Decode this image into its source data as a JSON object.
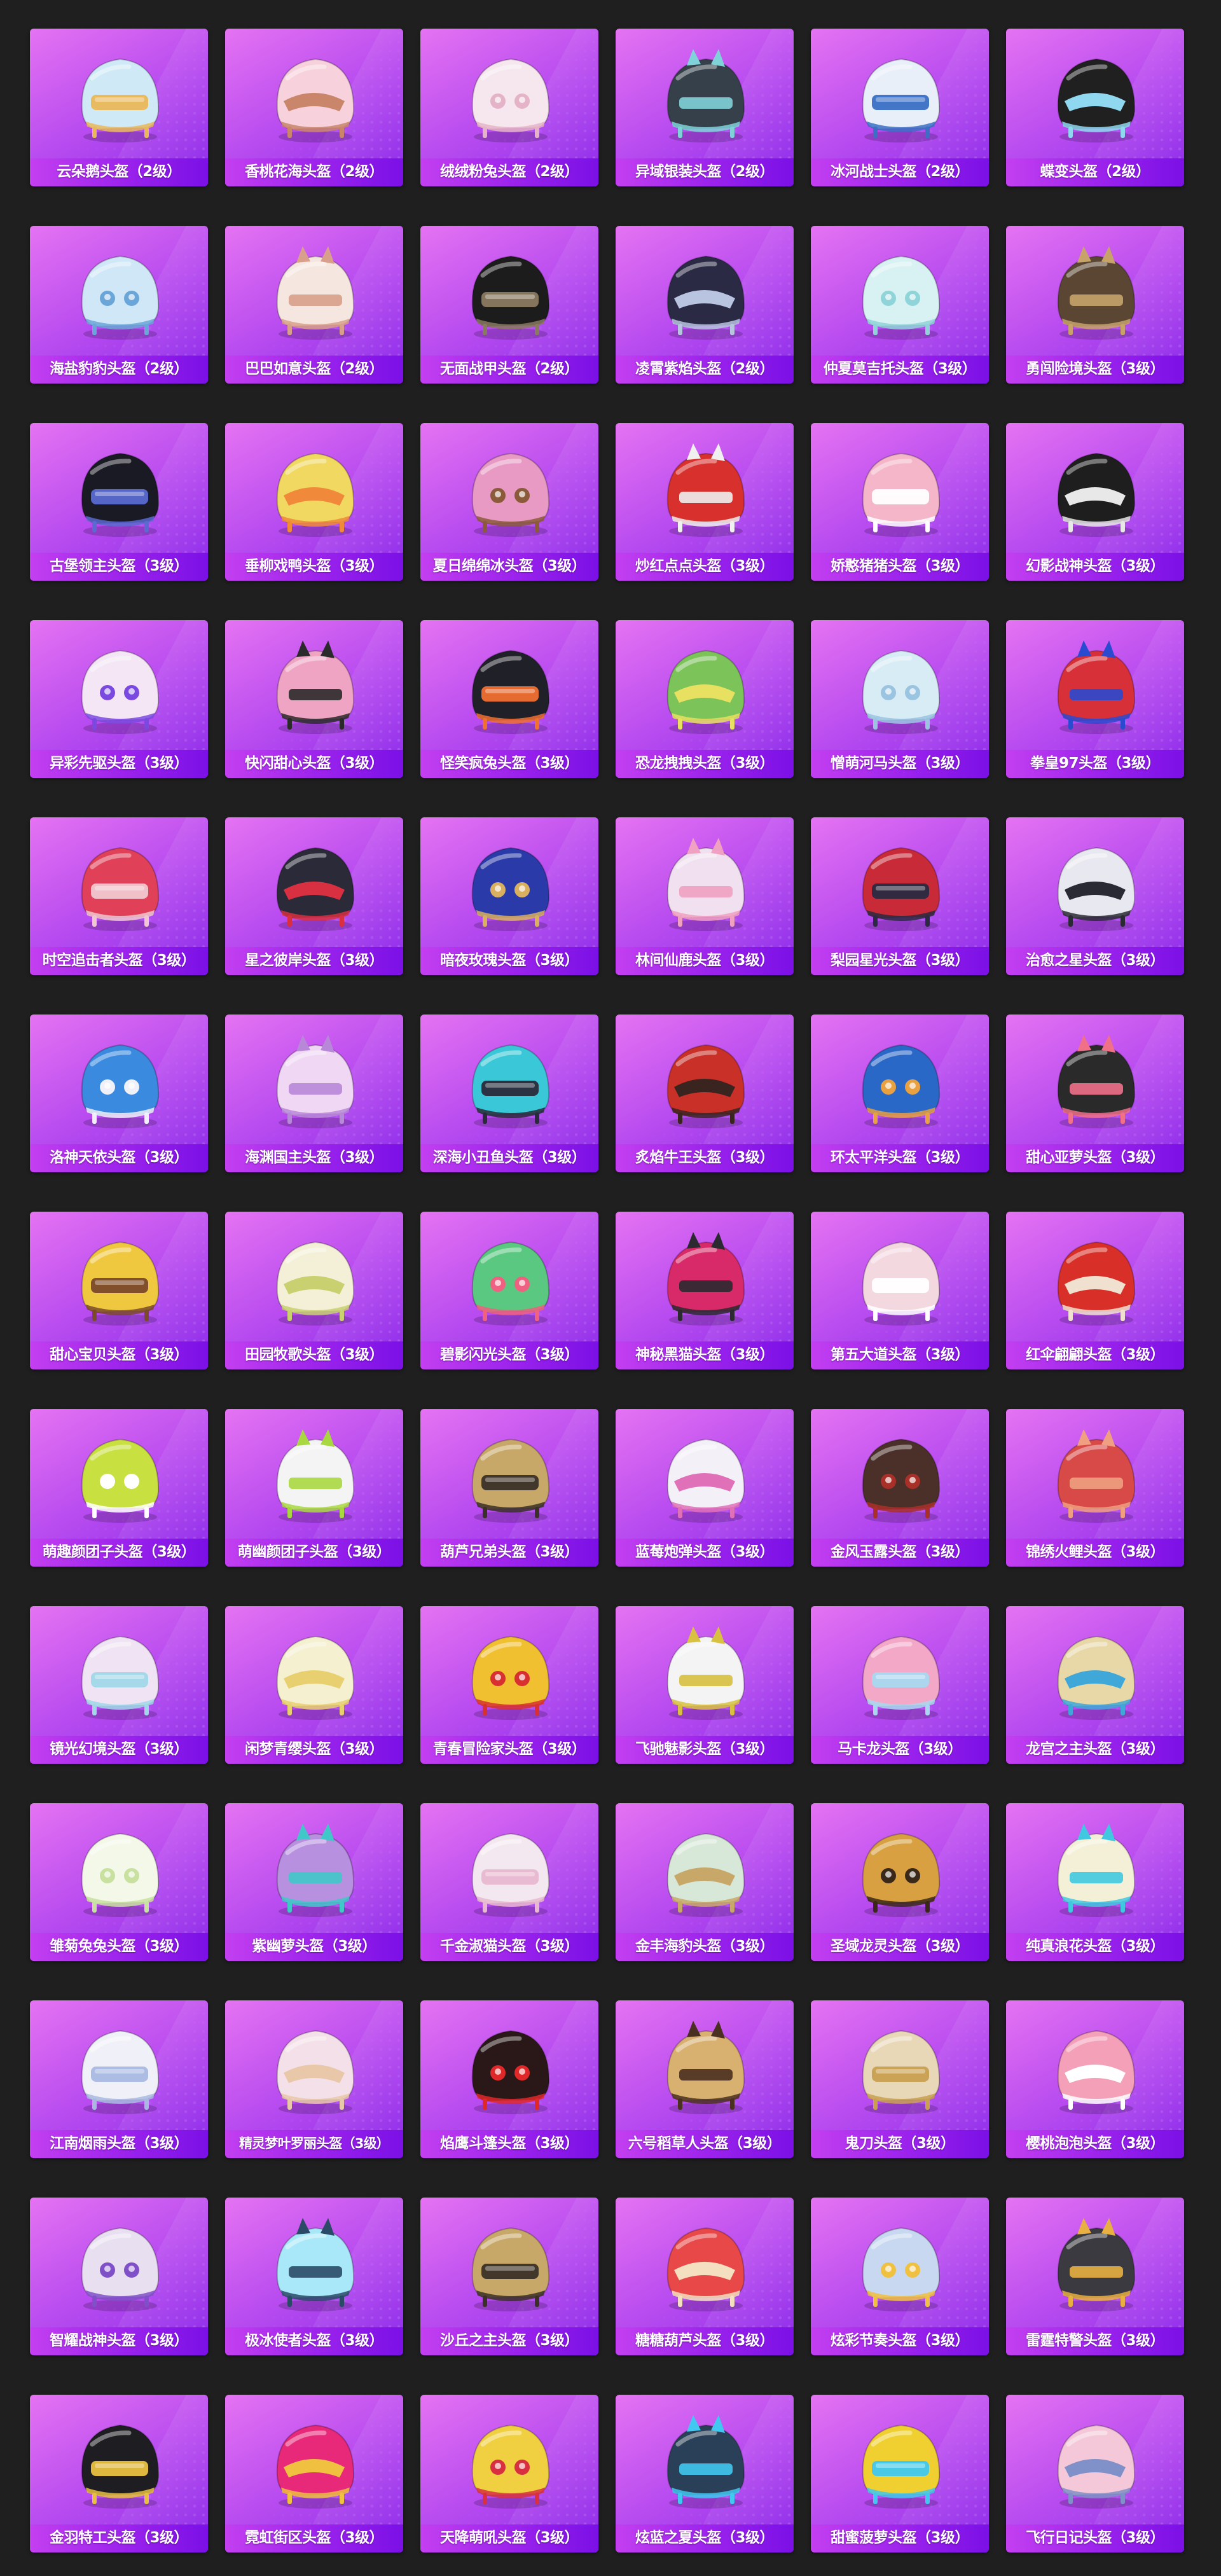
{
  "gallery": {
    "rows": [
      [
        {
          "label": "云朵鹅头盔（2级）",
          "icon": "cloud-goose-helmet-icon",
          "colors": [
            "#cfe9f6",
            "#e9b85a"
          ]
        },
        {
          "label": "香桃花海头盔（2级）",
          "icon": "peach-blossom-helmet-icon",
          "colors": [
            "#f7d2dc",
            "#c9866b"
          ]
        },
        {
          "label": "绒绒粉兔头盔（2级）",
          "icon": "fluffy-pink-bunny-helmet-icon",
          "colors": [
            "#f6e6ee",
            "#e5b3c7"
          ]
        },
        {
          "label": "异域银装头盔（2级）",
          "icon": "exotic-silver-helmet-icon",
          "colors": [
            "#35404a",
            "#7fd3d8"
          ]
        },
        {
          "label": "冰河战士头盔（2级）",
          "icon": "glacier-warrior-helmet-icon",
          "colors": [
            "#e8eff8",
            "#3b6fc4"
          ]
        },
        {
          "label": "蝶变头盔（2级）",
          "icon": "butterfly-helmet-icon",
          "colors": [
            "#202020",
            "#8fd8f0"
          ]
        }
      ],
      [
        {
          "label": "海盐豹豹头盔（2级）",
          "icon": "sea-salt-leopard-helmet-icon",
          "colors": [
            "#cfe7f7",
            "#6aa6d8"
          ]
        },
        {
          "label": "巴巴如意头盔（2级）",
          "icon": "baba-ruyi-helmet-icon",
          "colors": [
            "#f5e6df",
            "#d8a08a"
          ]
        },
        {
          "label": "无面战甲头盔（2级）",
          "icon": "faceless-armor-helmet-icon",
          "colors": [
            "#1c1c1c",
            "#8a7a60"
          ]
        },
        {
          "label": "凌霄紫焰头盔（2级）",
          "icon": "purple-flame-helmet-icon",
          "colors": [
            "#2a2a45",
            "#b8c4e0"
          ]
        },
        {
          "label": "仲夏莫吉托头盔（3级）",
          "icon": "midsummer-mojito-helmet-icon",
          "colors": [
            "#d8f1f2",
            "#8ed4d8"
          ]
        },
        {
          "label": "勇闯险境头盔（3级）",
          "icon": "pirate-ship-helmet-icon",
          "colors": [
            "#5a4632",
            "#c7a36a"
          ]
        }
      ],
      [
        {
          "label": "古堡领主头盔（3级）",
          "icon": "castle-lord-helmet-icon",
          "colors": [
            "#1a1a24",
            "#5a6ad0"
          ]
        },
        {
          "label": "垂柳戏鸭头盔（3级）",
          "icon": "willow-duck-helmet-icon",
          "colors": [
            "#f1d860",
            "#f08a3a"
          ]
        },
        {
          "label": "夏日绵绵冰头盔（3级）",
          "icon": "summer-ice-helmet-icon",
          "colors": [
            "#e89ac4",
            "#8a5a3a"
          ]
        },
        {
          "label": "炒红点点头盔（3级）",
          "icon": "red-dots-helmet-icon",
          "colors": [
            "#d8302c",
            "#f0f0f0"
          ]
        },
        {
          "label": "娇憨猪猪头盔（3级）",
          "icon": "cute-pig-helmet-icon",
          "colors": [
            "#f4b6c8",
            "#ffffff"
          ]
        },
        {
          "label": "幻影战神头盔（3级）",
          "icon": "phantom-war-god-helmet-icon",
          "colors": [
            "#1e1e1e",
            "#e8e8e8"
          ]
        }
      ],
      [
        {
          "label": "异彩先驱头盔（3级）",
          "icon": "colorful-pioneer-helmet-icon",
          "colors": [
            "#f4e6f4",
            "#7a4ae0"
          ]
        },
        {
          "label": "快闪甜心头盔（3级）",
          "icon": "flash-sweetheart-helmet-icon",
          "colors": [
            "#f0a4c4",
            "#2a2a2a"
          ]
        },
        {
          "label": "怪笑疯兔头盔（3级）",
          "icon": "crazy-rabbit-helmet-icon",
          "colors": [
            "#202028",
            "#f07030"
          ]
        },
        {
          "label": "恐龙拽拽头盔（3级）",
          "icon": "dinosaur-helmet-icon",
          "colors": [
            "#7cc45a",
            "#e8e060"
          ]
        },
        {
          "label": "憎萌河马头盔（3级）",
          "icon": "hippo-helmet-icon",
          "colors": [
            "#d8ecf6",
            "#9ac4e0"
          ]
        },
        {
          "label": "拳皇97头盔（3级）",
          "icon": "kof97-helmet-icon",
          "colors": [
            "#d83038",
            "#2a4ad0"
          ]
        }
      ],
      [
        {
          "label": "时空追击者头盔（3级）",
          "icon": "time-chaser-helmet-icon",
          "colors": [
            "#e04058",
            "#f0c8d0"
          ]
        },
        {
          "label": "星之彼岸头盔（3级）",
          "icon": "star-shore-helmet-icon",
          "colors": [
            "#2a2a38",
            "#d83040"
          ]
        },
        {
          "label": "暗夜玫瑰头盔（3级）",
          "icon": "night-rose-helmet-icon",
          "colors": [
            "#2a3aa8",
            "#d8b060"
          ]
        },
        {
          "label": "林间仙鹿头盔（3级）",
          "icon": "forest-deer-helmet-icon",
          "colors": [
            "#f0e0f0",
            "#f0a0c0"
          ]
        },
        {
          "label": "梨园星光头盔（3级）",
          "icon": "opera-star-helmet-icon",
          "colors": [
            "#c82a38",
            "#2a2a40"
          ]
        },
        {
          "label": "治愈之星头盔（3级）",
          "icon": "healing-star-helmet-icon",
          "colors": [
            "#e8e8f0",
            "#2a2a34"
          ]
        }
      ],
      [
        {
          "label": "洛神天依头盔（3级）",
          "icon": "luo-tianyi-helmet-icon",
          "colors": [
            "#3a8ae0",
            "#f0f0f8"
          ]
        },
        {
          "label": "海渊国主头盔（3级）",
          "icon": "sea-abyss-lord-helmet-icon",
          "colors": [
            "#f0d8f4",
            "#b888d8"
          ]
        },
        {
          "label": "深海小丑鱼头盔（3级）",
          "icon": "clownfish-helmet-icon",
          "colors": [
            "#3ac8d8",
            "#2a2a3a"
          ]
        },
        {
          "label": "炙焰牛王头盔（3级）",
          "icon": "flame-bull-king-helmet-icon",
          "colors": [
            "#c83028",
            "#3a2420"
          ]
        },
        {
          "label": "环太平洋头盔（3级）",
          "icon": "pacific-rim-helmet-icon",
          "colors": [
            "#2a68c8",
            "#e8a040"
          ]
        },
        {
          "label": "甜心亚萝头盔（3级）",
          "icon": "sweet-yaluo-helmet-icon",
          "colors": [
            "#2a2a2a",
            "#f07088"
          ]
        }
      ],
      [
        {
          "label": "甜心宝贝头盔（3级）",
          "icon": "sweet-baby-helmet-icon",
          "colors": [
            "#f0c840",
            "#7a4a2a"
          ]
        },
        {
          "label": "田园牧歌头盔（3级）",
          "icon": "pastoral-helmet-icon",
          "colors": [
            "#f4f0d8",
            "#c8d070"
          ]
        },
        {
          "label": "碧影闪光头盔（3级）",
          "icon": "jade-flash-helmet-icon",
          "colors": [
            "#5ac880",
            "#f06080"
          ]
        },
        {
          "label": "神秘黑猫头盔（3级）",
          "icon": "mystic-black-cat-helmet-icon",
          "colors": [
            "#d82a68",
            "#2a2a30"
          ]
        },
        {
          "label": "第五大道头盔（3级）",
          "icon": "fifth-avenue-helmet-icon",
          "colors": [
            "#f4d8e0",
            "#ffffff"
          ]
        },
        {
          "label": "红伞翩翩头盔（3级）",
          "icon": "red-umbrella-helmet-icon",
          "colors": [
            "#d83028",
            "#f0e0d0"
          ]
        }
      ],
      [
        {
          "label": "萌趣颜团子头盔（3级）",
          "icon": "cute-dumpling-helmet-icon",
          "colors": [
            "#c8e040",
            "#ffffff"
          ]
        },
        {
          "label": "萌幽颜团子头盔（3级）",
          "icon": "ghost-dumpling-helmet-icon",
          "colors": [
            "#f4f4f4",
            "#a8d840"
          ]
        },
        {
          "label": "葫芦兄弟头盔（3级）",
          "icon": "calabash-brothers-helmet-icon",
          "colors": [
            "#c8a868",
            "#3a3028"
          ]
        },
        {
          "label": "蓝莓炮弹头盔（3级）",
          "icon": "blueberry-cannon-helmet-icon",
          "colors": [
            "#f4f0f8",
            "#e070b8"
          ]
        },
        {
          "label": "金风玉露头盔（3级）",
          "icon": "golden-dew-helmet-icon",
          "colors": [
            "#4a3028",
            "#a83028"
          ]
        },
        {
          "label": "锦绣火鲤头盔（3级）",
          "icon": "fire-carp-helmet-icon",
          "colors": [
            "#d84a48",
            "#f0a080"
          ]
        }
      ],
      [
        {
          "label": "镜光幻境头盔（3级）",
          "icon": "mirror-fantasy-helmet-icon",
          "colors": [
            "#f0e4f4",
            "#a0d8e8"
          ]
        },
        {
          "label": "闲梦青缨头盔（3级）",
          "icon": "idle-dream-helmet-icon",
          "colors": [
            "#f4f0d0",
            "#e8d070"
          ]
        },
        {
          "label": "青春冒险家头盔（3级）",
          "icon": "youth-adventurer-helmet-icon",
          "colors": [
            "#f0c030",
            "#d83030"
          ]
        },
        {
          "label": "飞驰魅影头盔（3级）",
          "icon": "racing-phantom-helmet-icon",
          "colors": [
            "#f4f4f4",
            "#d8c040"
          ]
        },
        {
          "label": "马卡龙头盔（3级）",
          "icon": "macaron-helmet-icon",
          "colors": [
            "#f4a8c8",
            "#a8d8f0"
          ]
        },
        {
          "label": "龙宫之主头盔（3级）",
          "icon": "dragon-palace-helmet-icon",
          "colors": [
            "#e8d8a8",
            "#40a8d8"
          ]
        }
      ],
      [
        {
          "label": "雏菊兔兔头盔（3级）",
          "icon": "daisy-bunny-helmet-icon",
          "colors": [
            "#f4f8e8",
            "#c8e0a0"
          ]
        },
        {
          "label": "紫幽萝头盔（3级）",
          "icon": "purple-radish-helmet-icon",
          "colors": [
            "#b890e0",
            "#40c8c8"
          ]
        },
        {
          "label": "千金淑猫头盔（3级）",
          "icon": "noble-cat-helmet-icon",
          "colors": [
            "#f4e8f0",
            "#e8b8d0"
          ]
        },
        {
          "label": "金丰海豹头盔（3级）",
          "icon": "golden-seal-helmet-icon",
          "colors": [
            "#d8e8d8",
            "#c8a868"
          ]
        },
        {
          "label": "圣域龙灵头盔（3级）",
          "icon": "sanctuary-dragon-helmet-icon",
          "colors": [
            "#d8a040",
            "#3a2818"
          ]
        },
        {
          "label": "纯真浪花头盔（3级）",
          "icon": "pure-wave-helmet-icon",
          "colors": [
            "#f4f0d8",
            "#40c8e0"
          ]
        }
      ],
      [
        {
          "label": "江南烟雨头盔（3级）",
          "icon": "jiangnan-rain-helmet-icon",
          "colors": [
            "#f0f0f8",
            "#a8b8e0"
          ]
        },
        {
          "label": "精灵梦叶罗丽头盔（3级）",
          "icon": "fairy-dream-helmet-icon",
          "colors": [
            "#f4e0e8",
            "#e8c8a8"
          ]
        },
        {
          "label": "焰鹰斗篷头盔（3级）",
          "icon": "flame-eagle-helmet-icon",
          "colors": [
            "#2a1818",
            "#e02828"
          ]
        },
        {
          "label": "六号稻草人头盔（3级）",
          "icon": "scarecrow-helmet-icon",
          "colors": [
            "#d8b070",
            "#4a3020"
          ]
        },
        {
          "label": "鬼刀头盔（3级）",
          "icon": "ghost-blade-helmet-icon",
          "colors": [
            "#e8d8b8",
            "#c8a050"
          ]
        },
        {
          "label": "樱桃泡泡头盔（3级）",
          "icon": "cherry-bubble-helmet-icon",
          "colors": [
            "#f4a0b8",
            "#ffffff"
          ]
        }
      ],
      [
        {
          "label": "智耀战神头盔（3级）",
          "icon": "wisdom-war-god-helmet-icon",
          "colors": [
            "#e8e0f0",
            "#8050c8"
          ]
        },
        {
          "label": "极冰使者头盔（3级）",
          "icon": "ice-envoy-helmet-icon",
          "colors": [
            "#a8e8f8",
            "#2a4a68"
          ]
        },
        {
          "label": "沙丘之主头盔（3级）",
          "icon": "dune-lord-helmet-icon",
          "colors": [
            "#c8a868",
            "#3a3028"
          ]
        },
        {
          "label": "糖糖葫芦头盔（3级）",
          "icon": "candied-haw-helmet-icon",
          "colors": [
            "#e84848",
            "#f4e0c0"
          ]
        },
        {
          "label": "炫彩节奏头盔（3级）",
          "icon": "colorful-rhythm-helmet-icon",
          "colors": [
            "#c8d8f0",
            "#f0c040"
          ]
        },
        {
          "label": "雷霆特警头盔（3级）",
          "icon": "thunder-swat-helmet-icon",
          "colors": [
            "#3a3a40",
            "#e8b040"
          ]
        }
      ],
      [
        {
          "label": "金羽特工头盔（3级）",
          "icon": "golden-feather-agent-helmet-icon",
          "colors": [
            "#1e1e22",
            "#e8c040"
          ]
        },
        {
          "label": "霓虹街区头盔（3级）",
          "icon": "neon-street-helmet-icon",
          "colors": [
            "#e82878",
            "#f0c040"
          ]
        },
        {
          "label": "天降萌吼头盔（3级）",
          "icon": "cute-roar-helmet-icon",
          "colors": [
            "#f0d040",
            "#d83040"
          ]
        },
        {
          "label": "炫蓝之夏头盔（3级）",
          "icon": "blue-summer-helmet-icon",
          "colors": [
            "#2a4058",
            "#40c8f0"
          ]
        },
        {
          "label": "甜蜜菠萝头盔（3级）",
          "icon": "sweet-pineapple-helmet-icon",
          "colors": [
            "#f0d030",
            "#40c8f0"
          ]
        },
        {
          "label": "飞行日记头盔（3级）",
          "icon": "flight-diary-helmet-icon",
          "colors": [
            "#f4c8d8",
            "#8090c8"
          ]
        }
      ]
    ]
  }
}
